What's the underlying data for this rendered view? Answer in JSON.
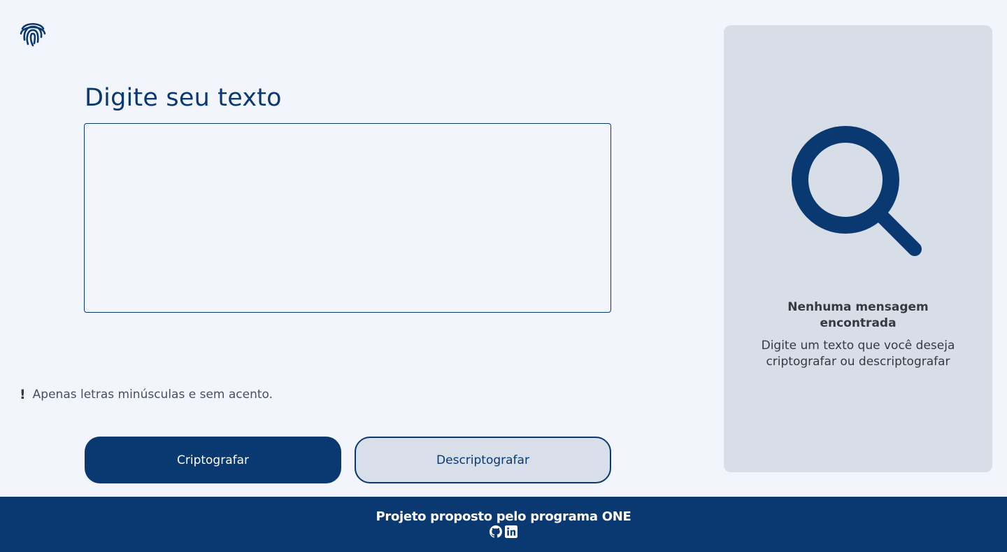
{
  "header": {
    "logo_icon": "fingerprint-icon"
  },
  "input": {
    "heading": "Digite seu texto",
    "value": "",
    "placeholder": ""
  },
  "warning": {
    "icon": "!",
    "text": "Apenas letras minúsculas e sem acento."
  },
  "buttons": {
    "encrypt_label": "Criptografar",
    "decrypt_label": "Descriptografar"
  },
  "output": {
    "illustration_icon": "magnifier-icon",
    "title": "Nenhuma mensagem encontrada",
    "message": "Digite um texto que você deseja criptografar ou descriptografar"
  },
  "footer": {
    "text": "Projeto proposto pelo programa ONE",
    "icons": [
      "github-icon",
      "linkedin-icon"
    ]
  },
  "colors": {
    "primary": "#0A3871",
    "background": "#F3F5FC",
    "panel": "#D8DEE8",
    "text_muted": "#495057"
  }
}
